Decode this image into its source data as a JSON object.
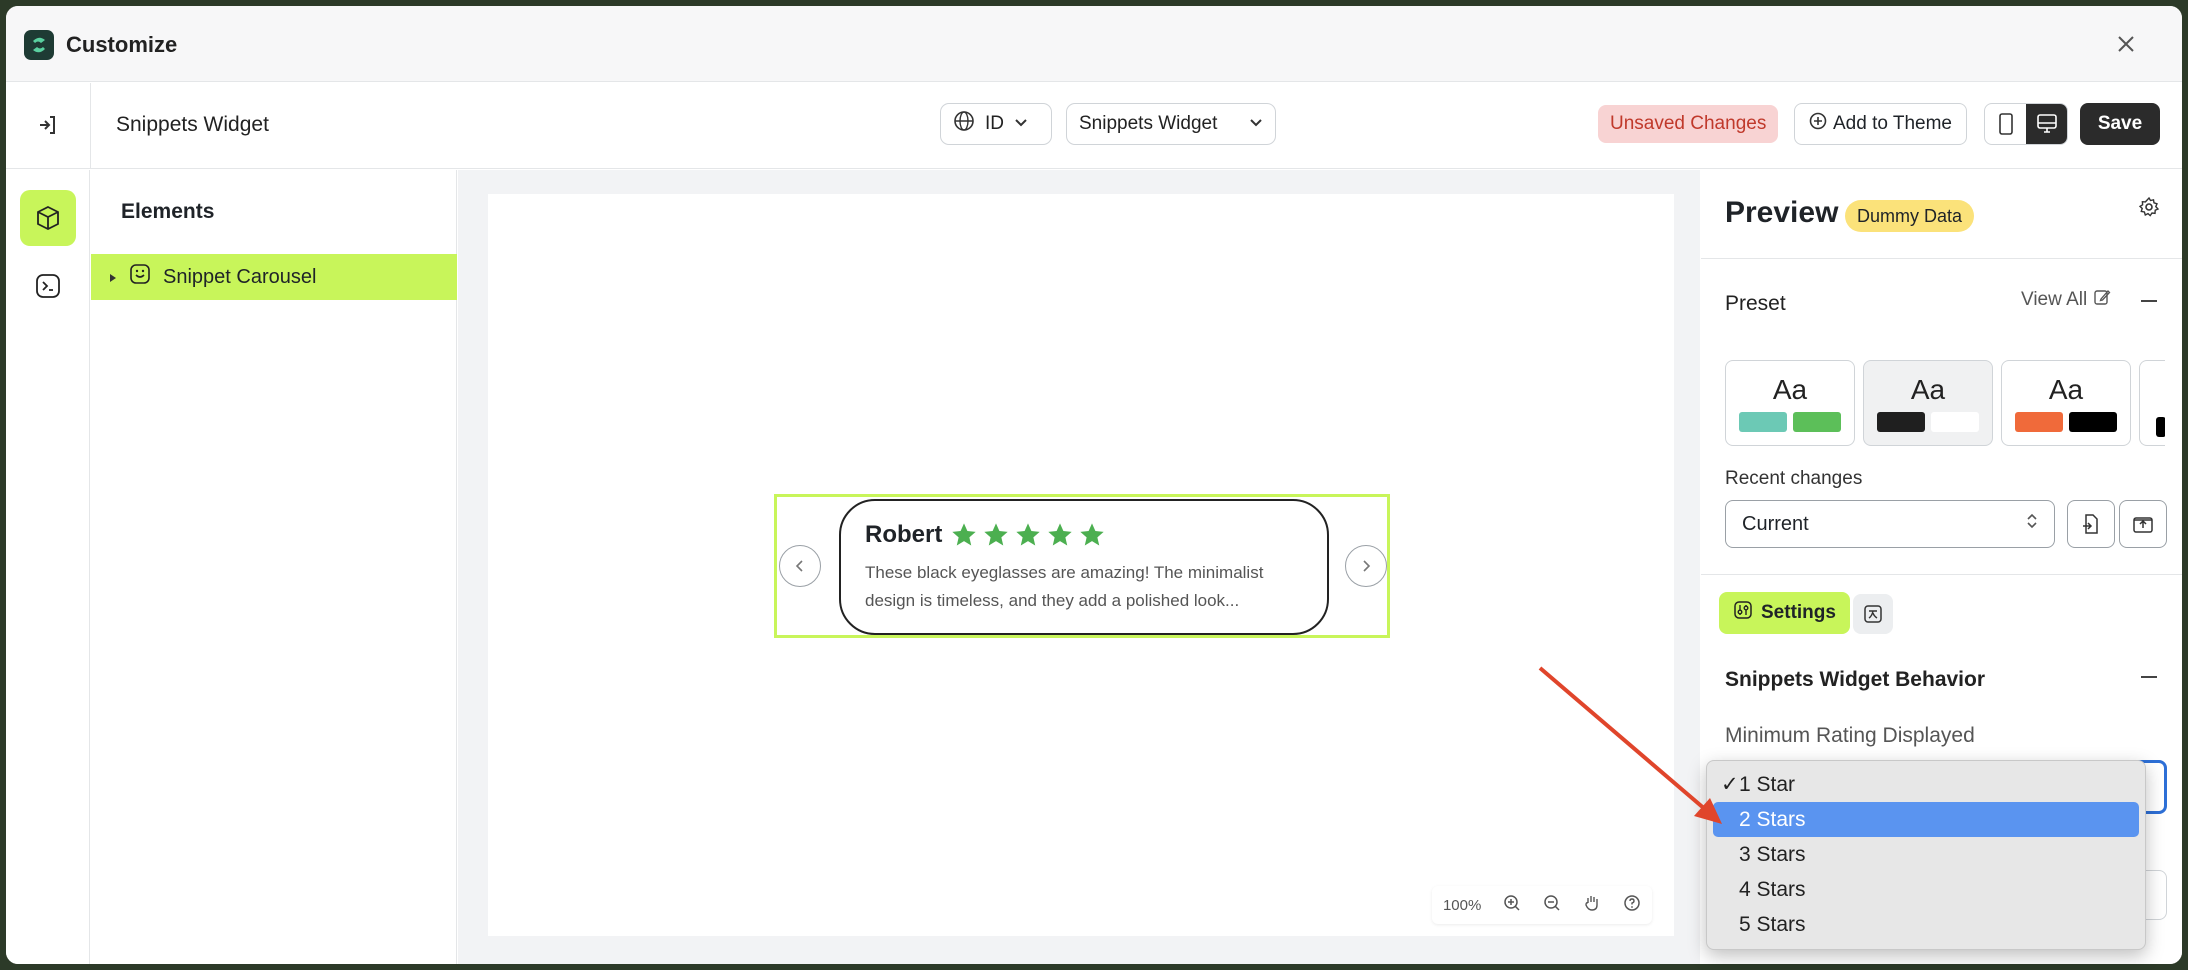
{
  "app": {
    "title": "Customize"
  },
  "toolbar": {
    "widget_title": "Snippets Widget",
    "language": "ID",
    "widget_select": "Snippets Widget",
    "unsaved": "Unsaved Changes",
    "add_to_theme": "Add to Theme",
    "save": "Save"
  },
  "elements": {
    "heading": "Elements",
    "items": [
      {
        "label": "Snippet Carousel"
      }
    ]
  },
  "canvas": {
    "review": {
      "name": "Robert",
      "stars": 5,
      "text_line1": "These black eyeglasses are amazing! The minimalist",
      "text_line2": "design is timeless, and they add a polished look..."
    },
    "zoom": "100%"
  },
  "panel": {
    "title": "Preview",
    "badge": "Dummy Data",
    "preset_title": "Preset",
    "view_all": "View All",
    "preset_glyph": "Aa",
    "presets": [
      {
        "glyph": "Aa",
        "colors": [
          "#6cc9b5",
          "#5cbf59"
        ]
      },
      {
        "glyph": "Aa",
        "colors": [
          "#1f1f1f",
          "#ffffff"
        ]
      },
      {
        "glyph": "Aa",
        "colors": [
          "#f06a3a",
          "#000000"
        ]
      }
    ],
    "recent_label": "Recent changes",
    "recent_value": "Current",
    "settings_tab": "Settings",
    "behavior_title": "Snippets Widget Behavior",
    "min_rating_label": "Minimum Rating Displayed"
  },
  "dropdown": {
    "options": [
      "1 Star",
      "2 Stars",
      "3 Stars",
      "4 Stars",
      "5 Stars"
    ],
    "selected_index": 0,
    "highlighted_index": 1,
    "check_mark": "✓"
  },
  "colors": {
    "accent": "#c8f55a",
    "star": "#4caf50",
    "focus": "#2d6fd6",
    "highlight": "#5a94f0",
    "annotation_arrow": "#e0452b"
  }
}
